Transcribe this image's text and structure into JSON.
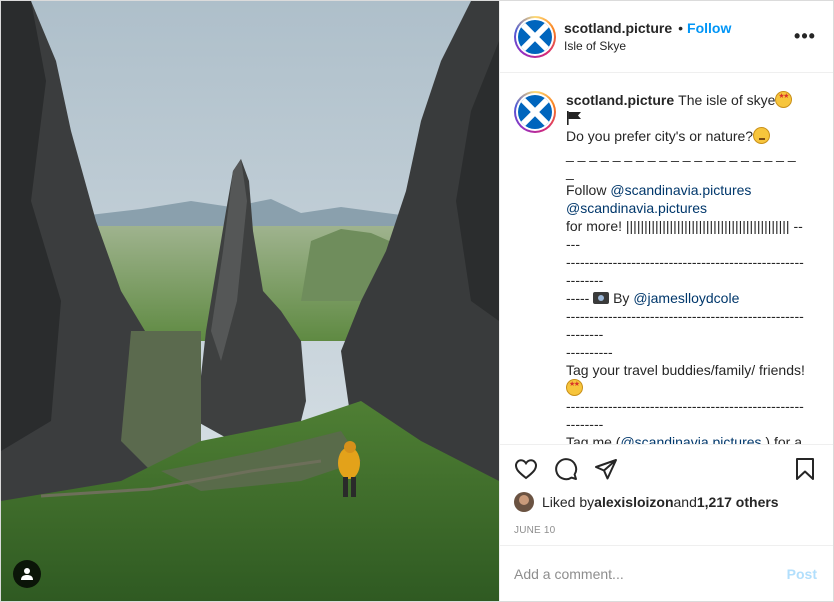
{
  "header": {
    "username": "scotland.picture",
    "separator": "•",
    "follow_label": "Follow",
    "location": "Isle of Skye",
    "more_label": "•••"
  },
  "caption": {
    "username": "scotland.picture",
    "line1": "The isle of skye",
    "line2": "Do you prefer city's or nature?",
    "dashes1": "_ _ _ _ _ _ _ _ _ _ _ _ _ _ _ _ _ _ _ _ _",
    "follow_prefix": "Follow ",
    "mention1": "@scandinavia.pictures",
    "mention2": "@scandinavia.pictures",
    "for_more": "for more! ||||||||||||||||||||||||||||||||||||||||||||| -----",
    "dashes2": "-----------------------------------------------------------",
    "by_pre": "----- ",
    "by_text": " By ",
    "mention3": "@jameslloydcole",
    "dashes3": "-----------------------------------------------------------",
    "dashes3b": "----------",
    "tag_text": "Tag your travel buddies/family/ friends! ",
    "dashes4": "-----------------------------------------------------------",
    "tagme_pre": "Tag me (",
    "mention4": "@scandinavia.pictures",
    "tagme_post": " ) for a repost!",
    "dashes5": "-----------------------------------------------------------",
    "dashes5b": "----------",
    "trailing": "."
  },
  "likes": {
    "prefix": "Liked by ",
    "user": "alexisloizon",
    "middle": " and ",
    "count": "1,217 others"
  },
  "date": "June 10",
  "comment_box": {
    "placeholder": "Add a comment...",
    "post_label": "Post"
  },
  "colors": {
    "link": "#0095f6",
    "mention": "#00376b",
    "muted": "#8e8e8e",
    "post_disabled": "#b2dffc"
  },
  "icons": [
    "heart-icon",
    "comment-icon",
    "share-icon",
    "bookmark-icon",
    "user-tag-icon",
    "more-icon"
  ]
}
